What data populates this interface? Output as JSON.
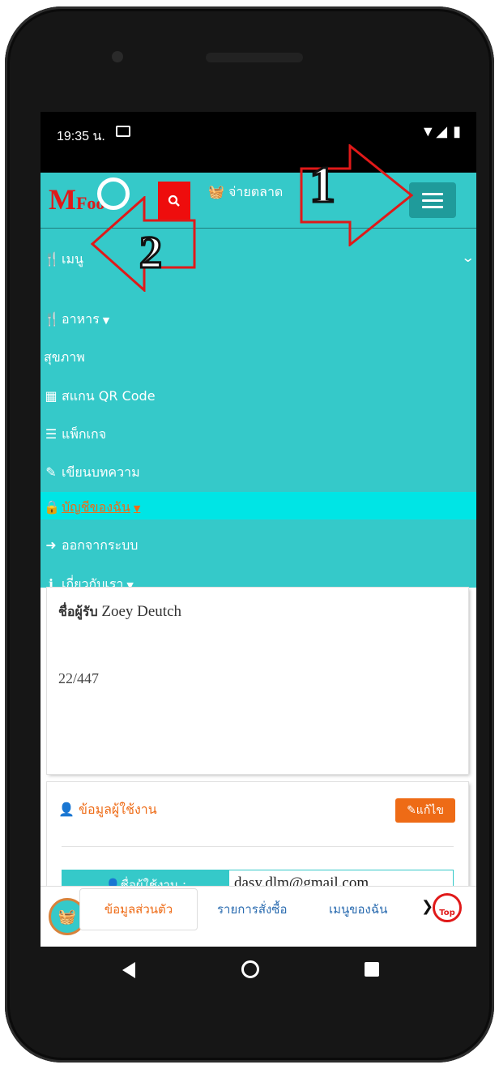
{
  "status": {
    "time": "19:35 น.",
    "mail_icon": "mail-icon",
    "right_icons": "▼◢ ▮"
  },
  "header": {
    "logo_m": "M",
    "logo_food": "Food",
    "search_icon": "🔍",
    "market_label": "จ่ายตลาด"
  },
  "annotations": {
    "one": "1",
    "two": "2"
  },
  "menu": {
    "toggle_label": "เมนู",
    "items": [
      {
        "label": "อาหาร",
        "icon": "utensils-icon",
        "caret": true
      },
      {
        "label": "สุขภาพ",
        "icon": "",
        "caret": false
      },
      {
        "label": "สแกน QR Code",
        "icon": "qrcode-icon",
        "caret": false
      },
      {
        "label": "แพ็กเกจ",
        "icon": "package-icon",
        "caret": false
      },
      {
        "label": "เขียนบทความ",
        "icon": "edit-icon",
        "caret": false
      },
      {
        "label": "บัญชีของฉัน",
        "icon": "lock-icon",
        "caret": true
      },
      {
        "label": "ออกจากระบบ",
        "icon": "sign-out-icon",
        "caret": false
      },
      {
        "label": "เกี่ยวกับเรา",
        "icon": "info-icon",
        "caret": true
      }
    ]
  },
  "content": {
    "recipient_label": "ชื่อผู้รับ",
    "recipient_name": "Zoey Deutch",
    "address": "22/447",
    "section_title": "ข้อมูลผู้ใช้งาน",
    "edit_label": "แก้ไข",
    "username_label": "ชื่อผู้ใช้งาน :",
    "username_value": "dasy.dlm@gmail.com"
  },
  "bottom_nav": {
    "tabs": [
      "ข้อมูลส่วนตัว",
      "รายการสั่งซื้อ",
      "เมนูของฉัน"
    ],
    "more": "❯",
    "top_label": "Top"
  },
  "colors": {
    "teal": "#35c9c9",
    "orange": "#ee6b16",
    "red": "#e01919",
    "active_row": "#00e5e5"
  }
}
